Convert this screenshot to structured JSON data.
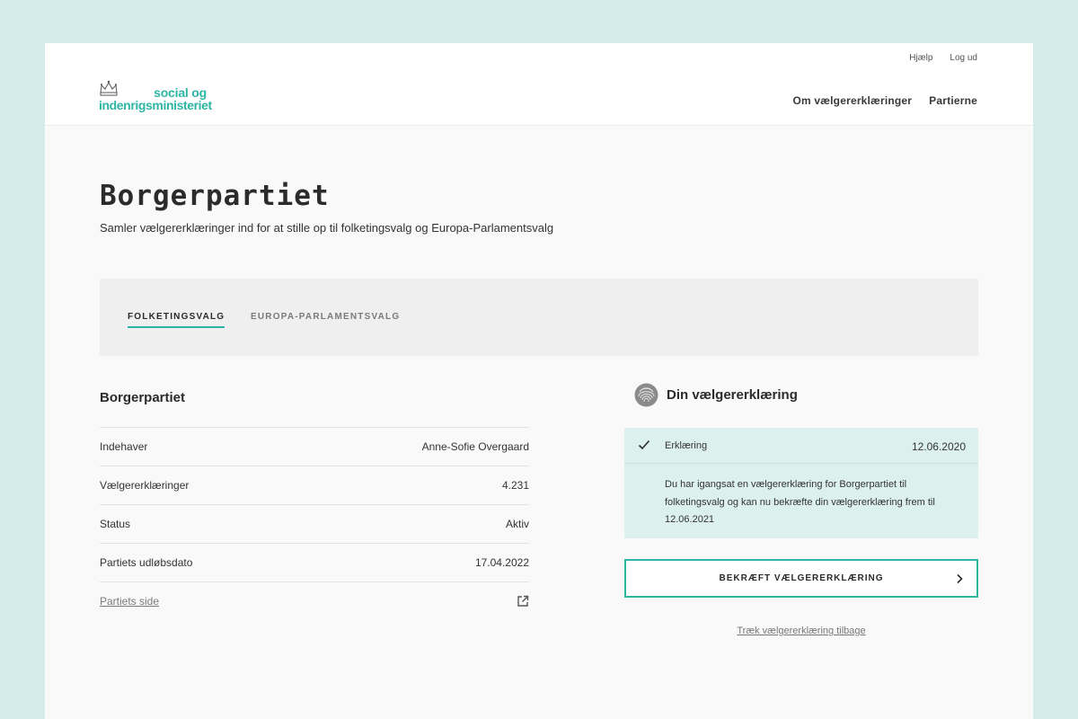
{
  "header": {
    "logo": {
      "line1": "social og",
      "line2": "indenrigsministeriet",
      "icon": "crown-icon"
    },
    "utility_links": [
      "Hjælp",
      "Log ud"
    ],
    "nav": [
      "Om vælgererklæringer",
      "Partierne"
    ]
  },
  "page": {
    "title": "Borgerpartiet",
    "subtitle": "Samler vælgererklæringer ind for at stille op til folketingsvalg og Europa-Parlamentsvalg"
  },
  "tabs": [
    {
      "label": "FOLKETINGSVALG",
      "active": true
    },
    {
      "label": "EUROPA-PARLAMENTSVALG",
      "active": false
    }
  ],
  "party_info": {
    "title": "Borgerpartiet",
    "rows": [
      {
        "label": "Indehaver",
        "value": "Anne-Sofie Overgaard"
      },
      {
        "label": "Vælgererklæringer",
        "value": "4.231"
      },
      {
        "label": "Status",
        "value": "Aktiv"
      },
      {
        "label": "Partiets udløbsdato",
        "value": "17.04.2022"
      }
    ],
    "link": {
      "label": "Partiets side",
      "icon": "external-link-icon"
    }
  },
  "declaration": {
    "title": "Din vælgererklæring",
    "icon": "fingerprint-icon",
    "status": {
      "label": "Erklæring",
      "date": "12.06.2020",
      "icon": "check-icon",
      "text": "Du har igangsat en vælgererklæring for Borgerpartiet til folketingsvalg og kan nu bekræfte din vælgererklæring frem til 12.06.2021"
    },
    "confirm_button": "BEKRÆFT VÆLGERERKLÆRING",
    "withdraw_link": "Træk vælgererklæring tilbage"
  },
  "colors": {
    "accent": "#2fb5a5",
    "backdrop": "#d5ecea",
    "status_bg": "#dcf0ee"
  }
}
